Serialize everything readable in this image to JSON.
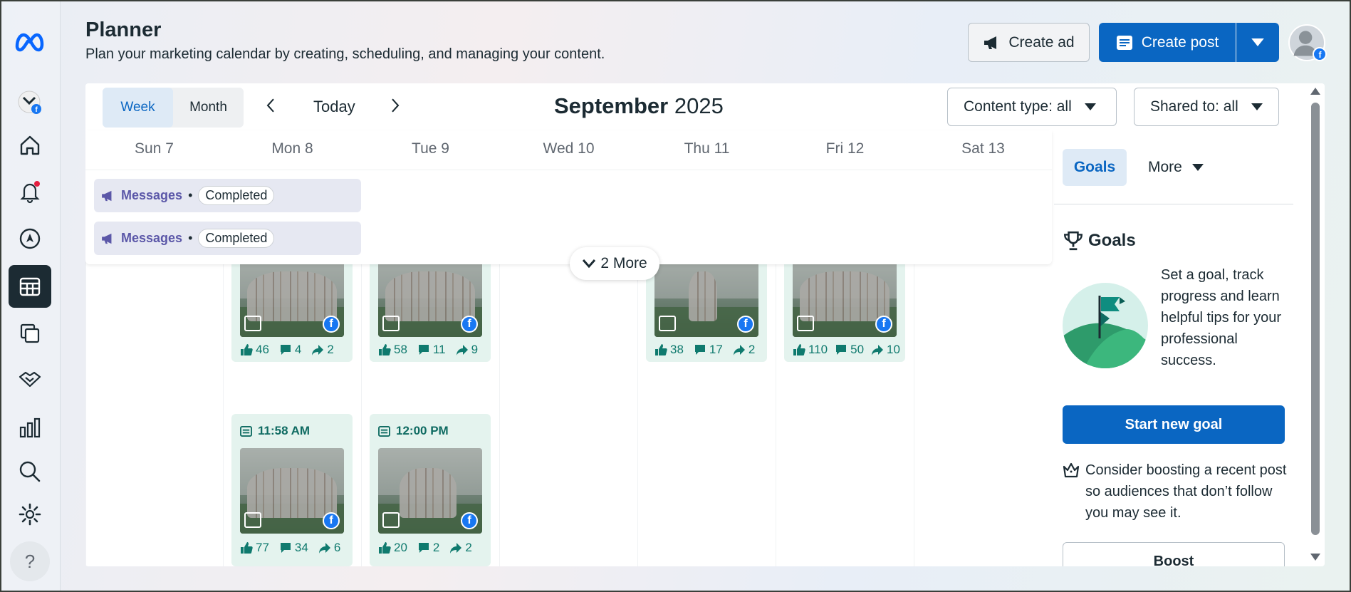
{
  "header": {
    "title": "Planner",
    "subtitle": "Plan your marketing calendar by creating, scheduling, and managing your content.",
    "create_ad": "Create ad",
    "create_post": "Create post"
  },
  "sidebar": {
    "items": [
      "meta-logo",
      "profile",
      "home",
      "notifications",
      "ads",
      "planner",
      "content",
      "partnerships",
      "insights",
      "search",
      "settings",
      "help"
    ],
    "help_label": "?",
    "notification_dot_color": "#e41e3f"
  },
  "toolbar": {
    "week": "Week",
    "month": "Month",
    "today": "Today",
    "month_name": "September",
    "year": "2025",
    "content_type": "Content type: all",
    "shared_to": "Shared to: all"
  },
  "days": [
    "Sun 7",
    "Mon 8",
    "Tue 9",
    "Wed 10",
    "Thu 11",
    "Fri 12",
    "Sat 13"
  ],
  "messages": [
    {
      "label": "Messages",
      "sep": "•",
      "status": "Completed"
    },
    {
      "label": "Messages",
      "sep": "•",
      "status": "Completed"
    }
  ],
  "more_label": "2 More",
  "posts": [
    {
      "day": "Mon 8",
      "time": "",
      "likes": "46",
      "comments": "4",
      "shares": "2"
    },
    {
      "day": "Tue 9",
      "time": "",
      "likes": "58",
      "comments": "11",
      "shares": "9"
    },
    {
      "day": "Thu 11",
      "time": "",
      "likes": "38",
      "comments": "17",
      "shares": "2"
    },
    {
      "day": "Fri 12",
      "time": "",
      "likes": "110",
      "comments": "50",
      "shares": "10"
    },
    {
      "day": "Mon 8",
      "time": "11:58 AM",
      "likes": "77",
      "comments": "34",
      "shares": "6"
    },
    {
      "day": "Tue 9",
      "time": "12:00 PM",
      "likes": "20",
      "comments": "2",
      "shares": "2"
    }
  ],
  "right": {
    "goals_tab": "Goals",
    "more_tab": "More",
    "goals_heading": "Goals",
    "goals_text": "Set a goal, track progress and learn helpful tips for your professional success.",
    "start_goal": "Start new goal",
    "boost_tip": "Consider boosting a recent post so audiences that don’t follow you may see it.",
    "boost": "Boost"
  },
  "colors": {
    "accent": "#0a66c2",
    "post_bg": "#e4f3ee",
    "stat_color": "#0f7a6e",
    "message_bg": "#e6e8f2"
  }
}
